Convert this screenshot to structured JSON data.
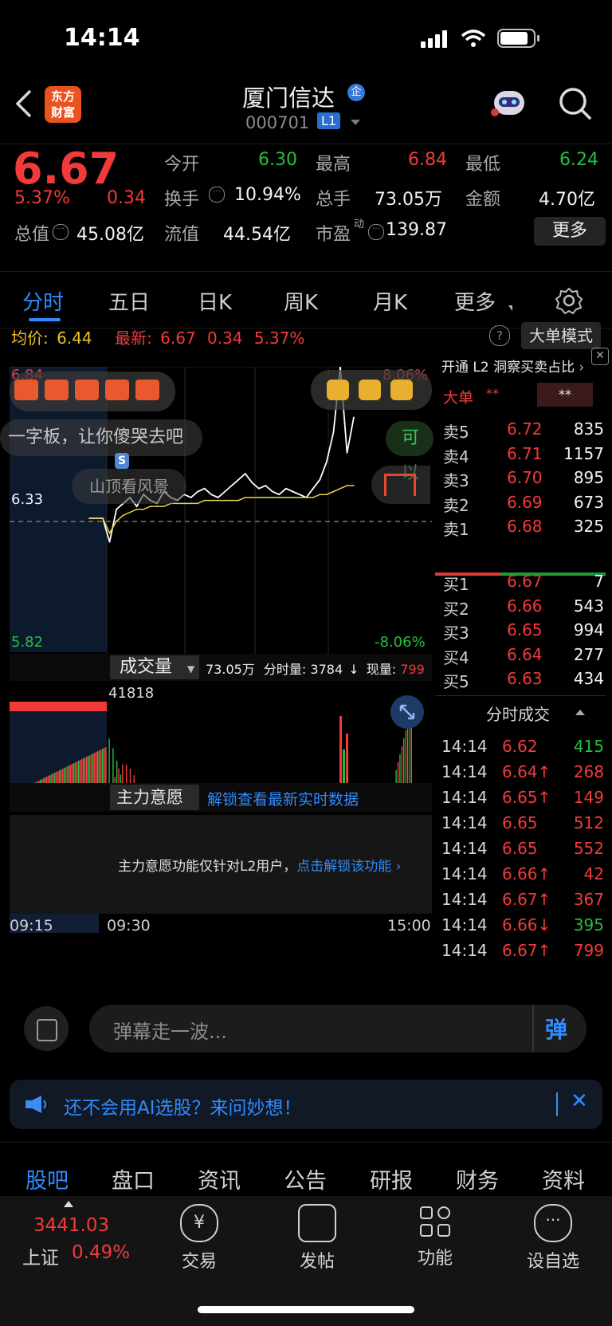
{
  "status": {
    "time": "14:14"
  },
  "nav": {
    "logo_line1": "东方",
    "logo_line2": "财富",
    "title": "厦门信达",
    "badge": "企",
    "code": "000701",
    "level": "L1"
  },
  "quote": {
    "price": "6.67",
    "pct": "5.37%",
    "change": "0.34",
    "open_label": "今开",
    "open": "6.30",
    "high_label": "最高",
    "high": "6.84",
    "low_label": "最低",
    "low": "6.24",
    "turnover_label": "换手",
    "turnover": "10.94%",
    "volume_label": "总手",
    "volume": "73.05万",
    "amount_label": "金额",
    "amount": "4.70亿",
    "mcap_label": "总值",
    "mcap": "45.08亿",
    "float_label": "流值",
    "float": "44.54亿",
    "pe_label": "市盈",
    "pe_sup": "动",
    "pe": "139.87",
    "more": "更多"
  },
  "tabs": [
    "分时",
    "五日",
    "日K",
    "周K",
    "月K",
    "更多"
  ],
  "chart_header": {
    "avg_label": "均价:",
    "avg": "6.44",
    "latest_label": "最新:",
    "latest": "6.67",
    "latest_chg": "0.34",
    "latest_pct": "5.37%",
    "bigorder_mode": "大单模式"
  },
  "chart_data": {
    "type": "line",
    "y_axis_left": {
      "top": "6.84",
      "mid": "6.33",
      "bottom": "5.82"
    },
    "y_axis_right": {
      "top": "8.06%",
      "bottom": "-8.06%"
    },
    "x_ticks": [
      "09:15",
      "09:30",
      "15:00"
    ],
    "volume_peak_label": "41818",
    "series": [
      {
        "values": [
          6.33,
          6.33,
          6.33,
          6.25,
          6.36,
          6.38,
          6.4,
          6.37,
          6.41,
          6.39,
          6.38,
          6.42,
          6.4,
          6.39,
          6.41,
          6.4,
          6.42,
          6.43,
          6.41,
          6.4,
          6.42,
          6.44,
          6.46,
          6.48,
          6.45,
          6.43,
          6.44,
          6.42,
          6.41,
          6.43,
          6.42,
          6.41,
          6.4,
          6.43,
          6.46,
          6.52,
          6.62,
          6.84,
          6.55,
          6.67
        ]
      },
      {
        "values": [
          6.33,
          6.33,
          6.33,
          6.28,
          6.32,
          6.34,
          6.35,
          6.36,
          6.36,
          6.37,
          6.37,
          6.37,
          6.38,
          6.38,
          6.38,
          6.38,
          6.38,
          6.39,
          6.39,
          6.39,
          6.39,
          6.39,
          6.39,
          6.4,
          6.4,
          6.4,
          6.4,
          6.4,
          6.4,
          6.4,
          6.4,
          6.4,
          6.4,
          6.4,
          6.41,
          6.41,
          6.42,
          6.43,
          6.44,
          6.44
        ]
      }
    ]
  },
  "overlay": {
    "banner_text": "一字板，让你傻哭去吧",
    "peak_text": "山顶看风景",
    "kyi": "可以",
    "s_marker": "S"
  },
  "volume_bar": {
    "label": "成交量",
    "total": "73.05万",
    "period_label": "分时量:",
    "period": "3784",
    "now_label": "现量:",
    "now": "799"
  },
  "main_force": {
    "label": "主力意愿",
    "unlock_link": "解锁查看最新实时数据",
    "notice": "主力意愿功能仅针对L2用户，",
    "notice_link": "点击解锁该功能"
  },
  "orderbook": {
    "promo": "开通 L2 洞察买卖占比",
    "big_label": "大单",
    "big_mask1": "**",
    "big_mask2": "**",
    "asks": [
      {
        "label": "卖5",
        "price": "6.72",
        "vol": "835"
      },
      {
        "label": "卖4",
        "price": "6.71",
        "vol": "1157"
      },
      {
        "label": "卖3",
        "price": "6.70",
        "vol": "895"
      },
      {
        "label": "卖2",
        "price": "6.69",
        "vol": "673"
      },
      {
        "label": "卖1",
        "price": "6.68",
        "vol": "325"
      }
    ],
    "bids": [
      {
        "label": "买1",
        "price": "6.67",
        "vol": "7"
      },
      {
        "label": "买2",
        "price": "6.66",
        "vol": "543"
      },
      {
        "label": "买3",
        "price": "6.65",
        "vol": "994"
      },
      {
        "label": "买4",
        "price": "6.64",
        "vol": "277"
      },
      {
        "label": "买5",
        "price": "6.63",
        "vol": "434"
      }
    ],
    "trades_title": "分时成交",
    "trades": [
      {
        "time": "14:14",
        "price": "6.62",
        "vol": "415",
        "dir": "g"
      },
      {
        "time": "14:14",
        "price": "6.64↑",
        "vol": "268",
        "dir": "r"
      },
      {
        "time": "14:14",
        "price": "6.65↑",
        "vol": "149",
        "dir": "r"
      },
      {
        "time": "14:14",
        "price": "6.65",
        "vol": "512",
        "dir": "r"
      },
      {
        "time": "14:14",
        "price": "6.65",
        "vol": "552",
        "dir": "r"
      },
      {
        "time": "14:14",
        "price": "6.66↑",
        "vol": "42",
        "dir": "r"
      },
      {
        "time": "14:14",
        "price": "6.67↑",
        "vol": "367",
        "dir": "r"
      },
      {
        "time": "14:14",
        "price": "6.66↓",
        "vol": "395",
        "dir": "g"
      },
      {
        "time": "14:14",
        "price": "6.67↑",
        "vol": "799",
        "dir": "r"
      }
    ]
  },
  "danmu": {
    "placeholder": "弹幕走一波...",
    "send": "弹"
  },
  "ai_banner": {
    "text": "还不会用AI选股？来问妙想！"
  },
  "bottom_tabs": [
    "股吧",
    "盘口",
    "资讯",
    "公告",
    "研报",
    "财务",
    "资料"
  ],
  "dock": {
    "index_value": "3441.03",
    "index_name": "上证",
    "index_pct": "0.49%",
    "items": [
      "交易",
      "发帖",
      "功能",
      "设自选"
    ]
  }
}
